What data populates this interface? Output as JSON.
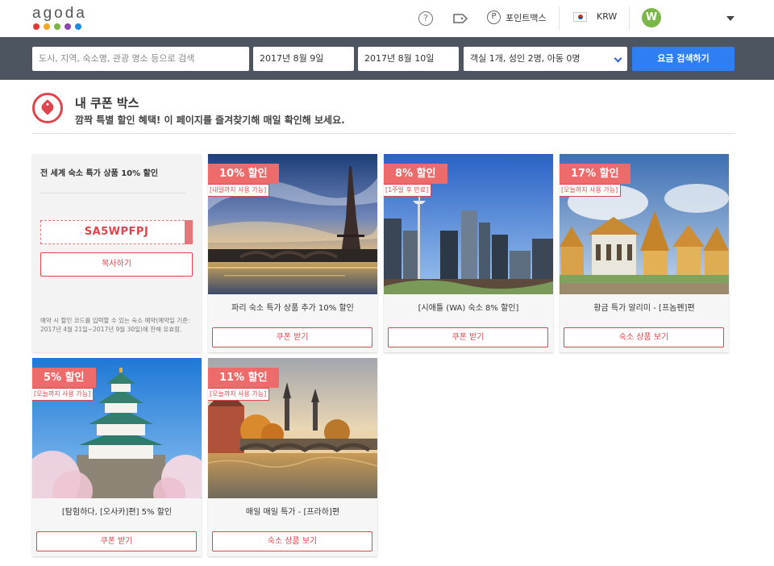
{
  "header": {
    "logo": "agoda",
    "logo_colors": [
      "#e53935",
      "#f5a623",
      "#7cb342",
      "#8e44ad",
      "#1e88e5"
    ],
    "help_icon": "?",
    "points_icon": "P",
    "points_label": "포인트맥스",
    "currency": "KRW",
    "avatar_initial": "W"
  },
  "search": {
    "destination_placeholder": "도시, 지역, 숙소명, 관광 명소 등으로 검색",
    "checkin": "2017년 8월 9일",
    "checkout": "2017년 8월 10일",
    "guests": "객실 1개, 성인 2명, 아동 0명",
    "search_button": "요금 검색하기"
  },
  "page": {
    "title": "내 쿠폰 박스",
    "subtitle": "깜짝 특별 할인 혜택! 이 페이지를 즐겨찾기해 매일 확인해 보세요."
  },
  "promo": {
    "title": "전 세계 숙소 특가 상품 10% 할인",
    "code": "SA5WPFPJ",
    "copy_button": "복사하기",
    "note": "예약 시 할인 코드를 입력할 수 있는 숙소 예약(예약일 기준: 2017년 4월 21일~2017년 9월 30일)에 한해 유효함."
  },
  "deals": [
    {
      "percent": "10% 할인",
      "note": "[내일까지 사용 가능]",
      "title": "파리 숙소 특가 상품 추가 10% 할인",
      "button": "쿠폰 받기"
    },
    {
      "percent": "8% 할인",
      "note": "[1주일 후 만료]",
      "title": "[시애틀 (WA) 숙소 8% 할인]",
      "button": "쿠폰 받기"
    },
    {
      "percent": "17% 할인",
      "note": "[오늘까지 사용 가능]",
      "title": "황금 특가 알리미 - [프놈펜]편",
      "button": "숙소 상품 보기"
    },
    {
      "percent": "5% 할인",
      "note": "[오늘까지 사용 가능]",
      "title": "[탐험하다, [오사카]편] 5% 할인",
      "button": "쿠폰 받기"
    },
    {
      "percent": "11% 할인",
      "note": "[오늘까지 사용 가능]",
      "title": "매일 매일 특가 - [프라하]편",
      "button": "숙소 상품 보기"
    }
  ]
}
